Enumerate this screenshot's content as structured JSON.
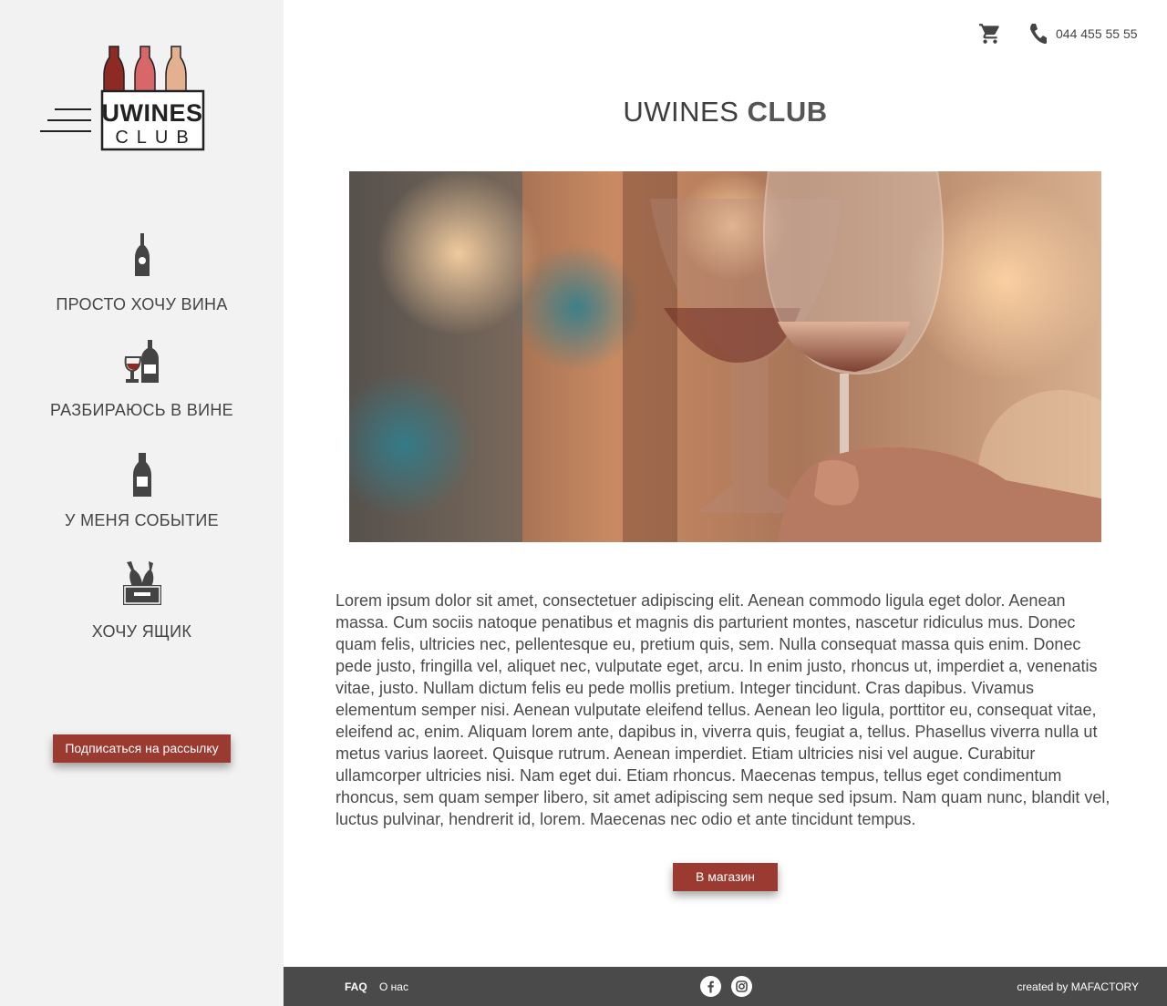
{
  "brand": {
    "logo_main": "UWINES",
    "logo_sub": "CLUB"
  },
  "sidebar": {
    "items": [
      {
        "label": "ПРОСТО ХОЧУ ВИНА",
        "icon": "wine-bottle-icon"
      },
      {
        "label": "РАЗБИРАЮСЬ В ВИНЕ",
        "icon": "glass-and-bottle-icon"
      },
      {
        "label": "У МЕНЯ СОБЫТИЕ",
        "icon": "champagne-bottle-icon"
      },
      {
        "label": "ХОЧУ ЯЩИК",
        "icon": "wine-crate-icon"
      }
    ],
    "subscribe_label": "Подписаться на рассылку"
  },
  "topbar": {
    "cart_icon": "cart-icon",
    "phone_icon": "phone-icon",
    "phone": "044 455 55 55"
  },
  "main": {
    "title_strong": "UWINES",
    "title_light": "CLUB",
    "hero_alt": "",
    "body": "Lorem ipsum dolor sit amet, consectetuer adipiscing elit. Aenean commodo ligula eget dolor. Aenean massa. Cum sociis natoque penatibus et magnis dis parturient montes, nascetur ridiculus mus. Donec quam felis, ultricies nec, pellentesque eu, pretium quis, sem. Nulla consequat massa quis enim. Donec pede justo, fringilla vel, aliquet nec, vulputate eget, arcu. In enim justo, rhoncus ut, imperdiet a, venenatis vitae, justo. Nullam dictum felis eu pede mollis pretium. Integer tincidunt. Cras dapibus. Vivamus elementum semper nisi. Aenean vulputate eleifend tellus. Aenean leo ligula, porttitor eu, consequat vitae, eleifend ac, enim. Aliquam lorem ante, dapibus in, viverra quis, feugiat a, tellus. Phasellus viverra nulla ut metus varius laoreet. Quisque rutrum. Aenean imperdiet. Etiam ultricies nisi vel augue. Curabitur ullamcorper ultricies nisi. Nam eget dui. Etiam rhoncus. Maecenas tempus, tellus eget condimentum rhoncus, sem quam semper libero, sit amet adipiscing sem neque sed ipsum. Nam quam nunc, blandit vel, luctus pulvinar, hendrerit id, lorem. Maecenas nec odio et ante tincidunt tempus.",
    "shop_label": "В магазин"
  },
  "footer": {
    "faq": "FAQ",
    "about": "О нас",
    "credit": "created by MAFACTORY",
    "social": [
      "facebook-icon",
      "instagram-icon"
    ]
  },
  "colors": {
    "accent": "#9b3a30",
    "sidebar_bg": "#f2f2f2",
    "footer_bg": "#4a4a4a",
    "text": "#4a4a4a"
  }
}
